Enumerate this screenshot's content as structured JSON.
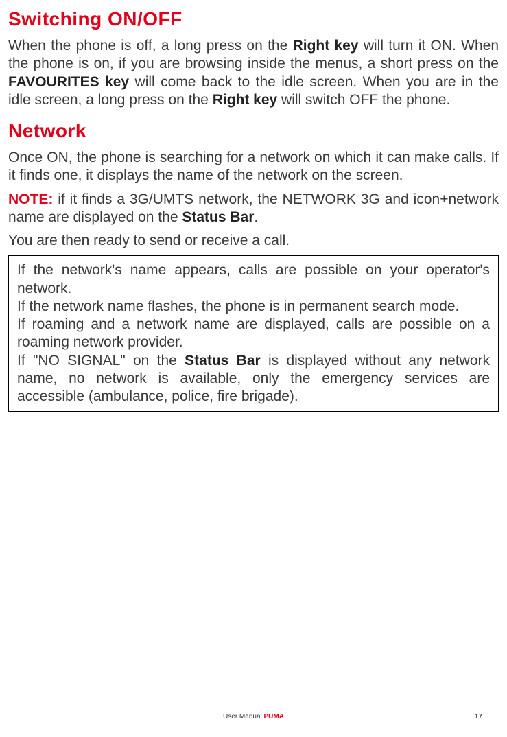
{
  "section1": {
    "title": "Switching ON/OFF",
    "p1_a": "When the phone is off, a long press on the ",
    "p1_b1": "Right key",
    "p1_c": " will turn it ON. When the phone is on, if you are browsing inside the menus, a short press on the ",
    "p1_b2": "FAVOURITES key",
    "p1_d": " will come back to the idle screen. When you are in the idle screen, a long press on the ",
    "p1_b3": "Right key",
    "p1_e": " will switch OFF the phone."
  },
  "section2": {
    "title": "Network",
    "p1": "Once ON, the phone is searching for a network on which it can make calls. If it finds one, it displays the name of the network on the screen.",
    "note_label": "NOTE:",
    "note_a": " if it finds a 3G/UMTS network, the NETWORK 3G and icon+network name are displayed on the ",
    "note_b": "Status Bar",
    "note_c": ".",
    "p2": "You are then ready to send or receive a call.",
    "box": {
      "l1": "If the network's name appears, calls are possible on your operator's network.",
      "l2": "If the network name flashes, the phone is in permanent search mode.",
      "l3": "If roaming and a network name are displayed, calls are possible on a roaming network provider.",
      "l4_a": "If \"NO SIGNAL\" on the ",
      "l4_b": "Status Bar",
      "l4_c": " is displayed without any network name, no network is available, only the emergency services are accessible (ambulance, police, fire brigade)."
    }
  },
  "footer": {
    "label": "User Manual ",
    "brand": "PUMA",
    "page": "17"
  }
}
